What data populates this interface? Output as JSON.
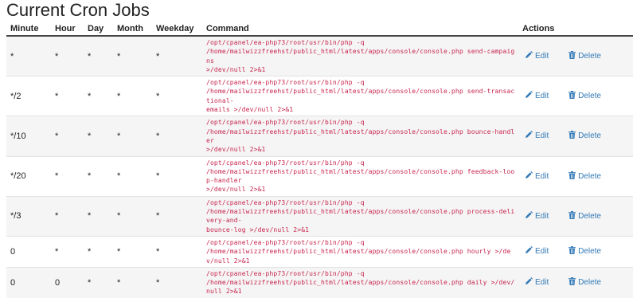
{
  "page": {
    "title": "Current Cron Jobs"
  },
  "table": {
    "headers": {
      "minute": "Minute",
      "hour": "Hour",
      "day": "Day",
      "month": "Month",
      "weekday": "Weekday",
      "command": "Command",
      "actions": "Actions"
    },
    "edit_label": "Edit",
    "delete_label": "Delete",
    "rows": [
      {
        "minute": "*",
        "hour": "*",
        "day": "*",
        "month": "*",
        "weekday": "*",
        "command": "/opt/cpanel/ea-php73/root/usr/bin/php -q\n/home/mailwizzfreehst/public_html/latest/apps/console/console.php send-campaigns\n>/dev/null 2>&1"
      },
      {
        "minute": "*/2",
        "hour": "*",
        "day": "*",
        "month": "*",
        "weekday": "*",
        "command": "/opt/cpanel/ea-php73/root/usr/bin/php -q\n/home/mailwizzfreehst/public_html/latest/apps/console/console.php send-transactional-\nemails >/dev/null 2>&1"
      },
      {
        "minute": "*/10",
        "hour": "*",
        "day": "*",
        "month": "*",
        "weekday": "*",
        "command": "/opt/cpanel/ea-php73/root/usr/bin/php -q\n/home/mailwizzfreehst/public_html/latest/apps/console/console.php bounce-handler\n>/dev/null 2>&1"
      },
      {
        "minute": "*/20",
        "hour": "*",
        "day": "*",
        "month": "*",
        "weekday": "*",
        "command": "/opt/cpanel/ea-php73/root/usr/bin/php -q\n/home/mailwizzfreehst/public_html/latest/apps/console/console.php feedback-loop-handler\n>/dev/null 2>&1"
      },
      {
        "minute": "*/3",
        "hour": "*",
        "day": "*",
        "month": "*",
        "weekday": "*",
        "command": "/opt/cpanel/ea-php73/root/usr/bin/php -q\n/home/mailwizzfreehst/public_html/latest/apps/console/console.php process-delivery-and-\nbounce-log >/dev/null 2>&1"
      },
      {
        "minute": "0",
        "hour": "*",
        "day": "*",
        "month": "*",
        "weekday": "*",
        "command": "/opt/cpanel/ea-php73/root/usr/bin/php -q\n/home/mailwizzfreehst/public_html/latest/apps/console/console.php hourly >/dev/null 2>&1"
      },
      {
        "minute": "0",
        "hour": "0",
        "day": "*",
        "month": "*",
        "weekday": "*",
        "command": "/opt/cpanel/ea-php73/root/usr/bin/php -q\n/home/mailwizzfreehst/public_html/latest/apps/console/console.php daily >/dev/null 2>&1"
      }
    ]
  },
  "icons": {
    "edit": "pencil-icon",
    "delete": "trash-icon"
  },
  "colors": {
    "command_text": "#c7254e",
    "link": "#337ab7",
    "row_stripe": "#f5f5f5"
  }
}
